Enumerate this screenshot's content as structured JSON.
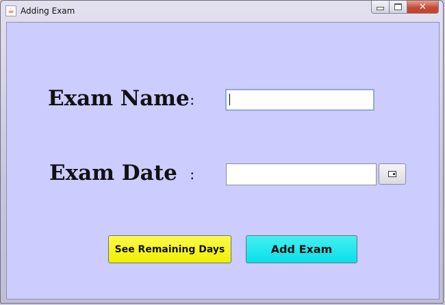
{
  "window": {
    "title": "Adding Exam",
    "icon": "java-cup-icon",
    "close_glyph": "✕"
  },
  "form": {
    "exam_name_label": "Exam Name",
    "exam_date_label": "Exam Date",
    "colon": ":",
    "exam_name_value": "",
    "exam_date_value": ""
  },
  "buttons": {
    "remaining_days": "See Remaining Days",
    "add_exam": "Add Exam"
  },
  "colors": {
    "content_bg": "#ccccff",
    "remaining_days_bg": "#f3f300",
    "add_exam_bg": "#11e6ee"
  }
}
